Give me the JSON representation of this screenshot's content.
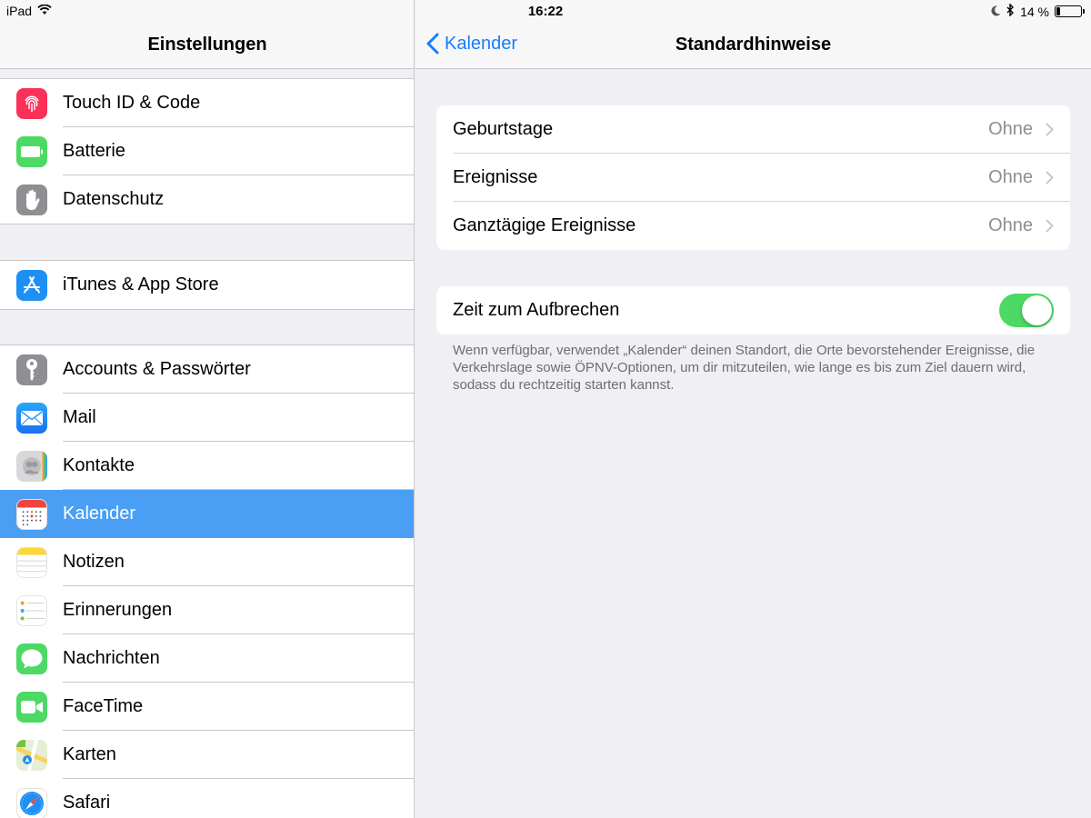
{
  "status_bar": {
    "device": "iPad",
    "time": "16:22",
    "battery_text": "14 %",
    "battery_level": 0.14,
    "icons": [
      "wifi-icon",
      "moon-icon",
      "bluetooth-icon",
      "battery-icon"
    ]
  },
  "master": {
    "title": "Einstellungen",
    "groups": [
      {
        "items": [
          {
            "label": "Touch ID & Code",
            "icon": "fingerprint-icon",
            "color": "#fc3158"
          },
          {
            "label": "Batterie",
            "icon": "battery-icon",
            "color": "#4cd964"
          },
          {
            "label": "Datenschutz",
            "icon": "hand-icon",
            "color": "#8e8e93"
          }
        ]
      },
      {
        "items": [
          {
            "label": "iTunes & App Store",
            "icon": "app-store-icon",
            "color": "#1e8ff5"
          }
        ]
      },
      {
        "items": [
          {
            "label": "Accounts & Passwörter",
            "icon": "key-icon",
            "color": "#8e8e93"
          },
          {
            "label": "Mail",
            "icon": "mail-icon",
            "color": "#1e8ff5"
          },
          {
            "label": "Kontakte",
            "icon": "contacts-icon",
            "color": "#c4c4c6"
          },
          {
            "label": "Kalender",
            "icon": "calendar-icon",
            "color": "#ffffff",
            "selected": true
          },
          {
            "label": "Notizen",
            "icon": "notes-icon",
            "color": "#ffffff"
          },
          {
            "label": "Erinnerungen",
            "icon": "reminders-icon",
            "color": "#ffffff"
          },
          {
            "label": "Nachrichten",
            "icon": "messages-icon",
            "color": "#4cd964"
          },
          {
            "label": "FaceTime",
            "icon": "facetime-icon",
            "color": "#4cd964"
          },
          {
            "label": "Karten",
            "icon": "maps-icon",
            "color": "#e8f0d8"
          },
          {
            "label": "Safari",
            "icon": "safari-icon",
            "color": "#ffffff"
          }
        ]
      }
    ]
  },
  "detail": {
    "back_label": "Kalender",
    "title": "Standardhinweise",
    "alerts": [
      {
        "label": "Geburtstage",
        "value": "Ohne"
      },
      {
        "label": "Ereignisse",
        "value": "Ohne"
      },
      {
        "label": "Ganztägige Ereignisse",
        "value": "Ohne"
      }
    ],
    "toggle": {
      "label": "Zeit zum Aufbrechen",
      "on": true
    },
    "footnote": "Wenn verfügbar, verwendet „Kalender“ deinen Standort, die Orte bevorstehender Ereignisse, die Verkehrslage sowie ÖPNV-Optionen, um dir mitzuteilen, wie lange es bis zum Ziel dauern wird, sodass du rechtzeitig starten kannst."
  },
  "colors": {
    "accent": "#147efb",
    "selection": "#4a9ff5",
    "toggle_on": "#4cd964",
    "background": "#efeff4"
  }
}
